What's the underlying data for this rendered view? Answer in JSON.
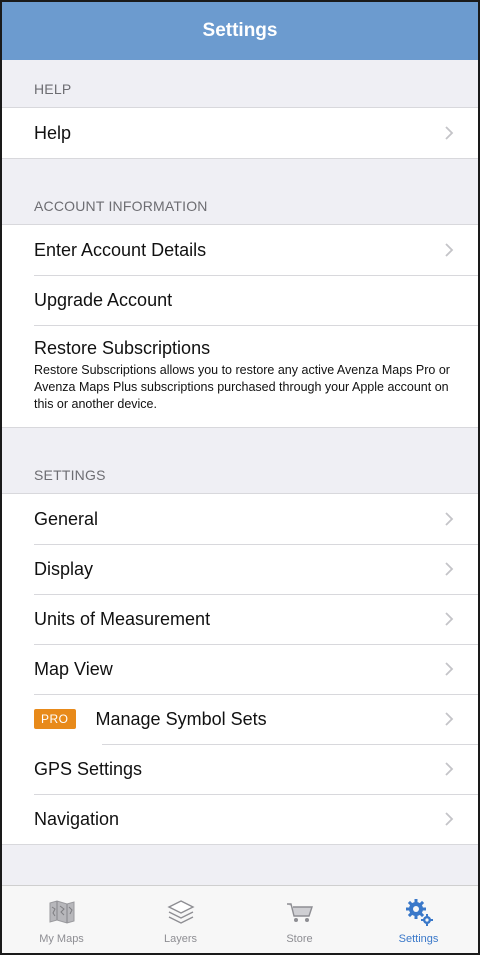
{
  "navbar": {
    "title": "Settings"
  },
  "sections": {
    "help": {
      "header": "HELP",
      "items": [
        "Help"
      ]
    },
    "account": {
      "header": "ACCOUNT INFORMATION",
      "enter_details": "Enter Account Details",
      "upgrade": "Upgrade Account",
      "restore_title": "Restore Subscriptions",
      "restore_desc": "Restore Subscriptions allows you to restore any active Avenza Maps Pro or Avenza Maps Plus subscriptions purchased through your Apple account on this or another device."
    },
    "settings": {
      "header": "SETTINGS",
      "general": "General",
      "display": "Display",
      "units": "Units of Measurement",
      "map_view": "Map View",
      "pro_badge": "PRO",
      "symbol_sets": "Manage Symbol Sets",
      "gps": "GPS Settings",
      "navigation": "Navigation"
    }
  },
  "tabbar": {
    "tabs": [
      {
        "label": "My Maps",
        "icon": "map-icon",
        "active": false
      },
      {
        "label": "Layers",
        "icon": "layers-icon",
        "active": false
      },
      {
        "label": "Store",
        "icon": "cart-icon",
        "active": false
      },
      {
        "label": "Settings",
        "icon": "gear-icon",
        "active": true
      }
    ]
  },
  "colors": {
    "navbar": "#6c9bcf",
    "accent": "#3a78c9",
    "pro_badge": "#e88a1a",
    "background": "#efeff4"
  }
}
